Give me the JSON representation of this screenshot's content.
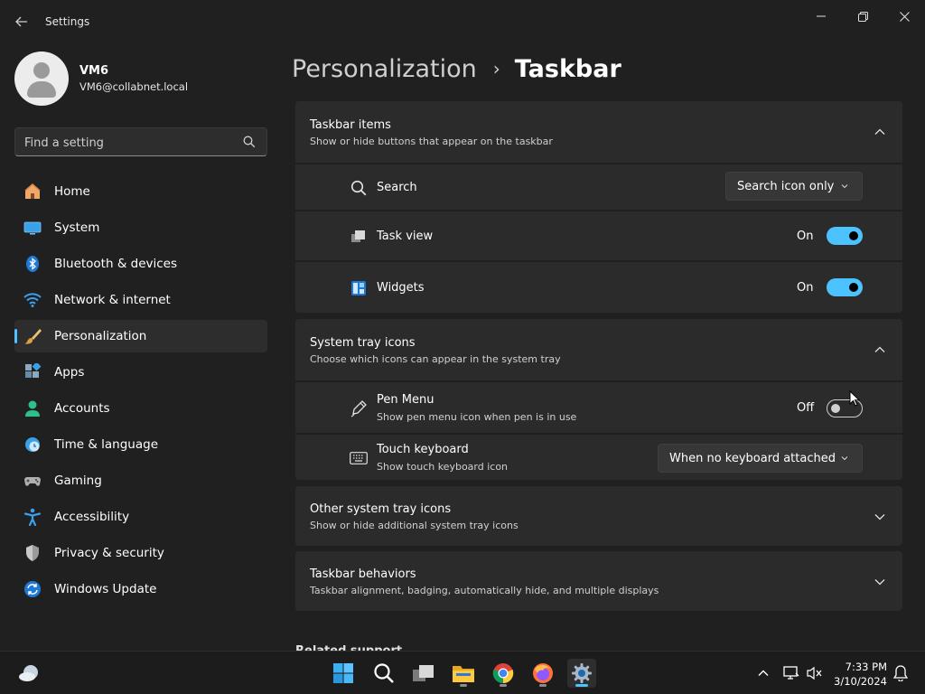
{
  "window": {
    "title": "Settings"
  },
  "profile": {
    "name": "VM6",
    "email": "VM6@collabnet.local"
  },
  "search": {
    "placeholder": "Find a setting"
  },
  "sidebar": {
    "items": [
      {
        "label": "Home",
        "icon": "home-icon"
      },
      {
        "label": "System",
        "icon": "system-icon"
      },
      {
        "label": "Bluetooth & devices",
        "icon": "bluetooth-icon"
      },
      {
        "label": "Network & internet",
        "icon": "wifi-icon"
      },
      {
        "label": "Personalization",
        "icon": "paintbrush-icon",
        "active": true
      },
      {
        "label": "Apps",
        "icon": "apps-icon"
      },
      {
        "label": "Accounts",
        "icon": "accounts-icon"
      },
      {
        "label": "Time & language",
        "icon": "clock-globe-icon"
      },
      {
        "label": "Gaming",
        "icon": "gamepad-icon"
      },
      {
        "label": "Accessibility",
        "icon": "accessibility-icon"
      },
      {
        "label": "Privacy & security",
        "icon": "shield-icon"
      },
      {
        "label": "Windows Update",
        "icon": "update-icon"
      }
    ]
  },
  "breadcrumb": {
    "parent": "Personalization",
    "separator": "›",
    "current": "Taskbar"
  },
  "taskbar_items": {
    "title": "Taskbar items",
    "description": "Show or hide buttons that appear on the taskbar",
    "expanded": true,
    "rows": {
      "search": {
        "label": "Search",
        "value": "Search icon only"
      },
      "task_view": {
        "label": "Task view",
        "state": "On"
      },
      "widgets": {
        "label": "Widgets",
        "state": "On"
      }
    }
  },
  "system_tray_icons": {
    "title": "System tray icons",
    "description": "Choose which icons can appear in the system tray",
    "expanded": true,
    "rows": {
      "pen_menu": {
        "label": "Pen Menu",
        "sublabel": "Show pen menu icon when pen is in use",
        "state": "Off"
      },
      "touch_keyboard": {
        "label": "Touch keyboard",
        "sublabel": "Show touch keyboard icon",
        "value": "When no keyboard attached"
      }
    }
  },
  "other_tray_icons": {
    "title": "Other system tray icons",
    "description": "Show or hide additional system tray icons"
  },
  "taskbar_behaviors": {
    "title": "Taskbar behaviors",
    "description": "Taskbar alignment, badging, automatically hide, and multiple displays"
  },
  "related": {
    "label": "Related support"
  },
  "os_taskbar": {
    "time": "7:33 PM",
    "date": "3/10/2024"
  },
  "colors": {
    "accent": "#4cc2ff",
    "background": "#202020",
    "panel": "#2b2b2b"
  }
}
